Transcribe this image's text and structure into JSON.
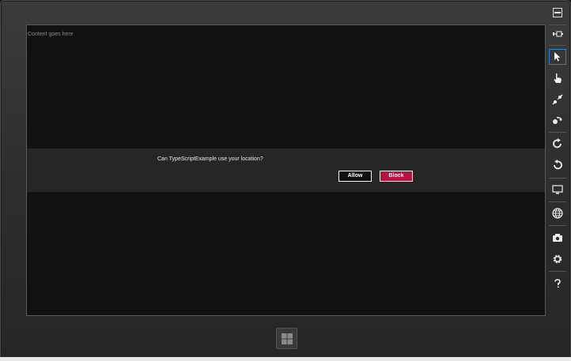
{
  "content": {
    "placeholder_text": "Content goes here"
  },
  "dialog": {
    "message": "Can TypeScriptExample use your location?",
    "allow_label": "Allow",
    "block_label": "Block"
  },
  "toolbar": {
    "items": [
      {
        "name": "minimize-icon"
      },
      {
        "name": "pin-icon"
      },
      {
        "name": "mouse-mode-icon",
        "selected": true
      },
      {
        "name": "touch-mode-icon"
      },
      {
        "name": "pinch-zoom-icon"
      },
      {
        "name": "rotate-touch-icon"
      },
      {
        "name": "rotate-clockwise-icon"
      },
      {
        "name": "rotate-counterclockwise-icon"
      },
      {
        "name": "change-resolution-icon"
      },
      {
        "name": "set-location-icon"
      },
      {
        "name": "screenshot-icon"
      },
      {
        "name": "settings-icon"
      },
      {
        "name": "help-icon"
      }
    ]
  },
  "colors": {
    "block_button": "#b8123e",
    "selected_border": "#2f7fd1"
  }
}
